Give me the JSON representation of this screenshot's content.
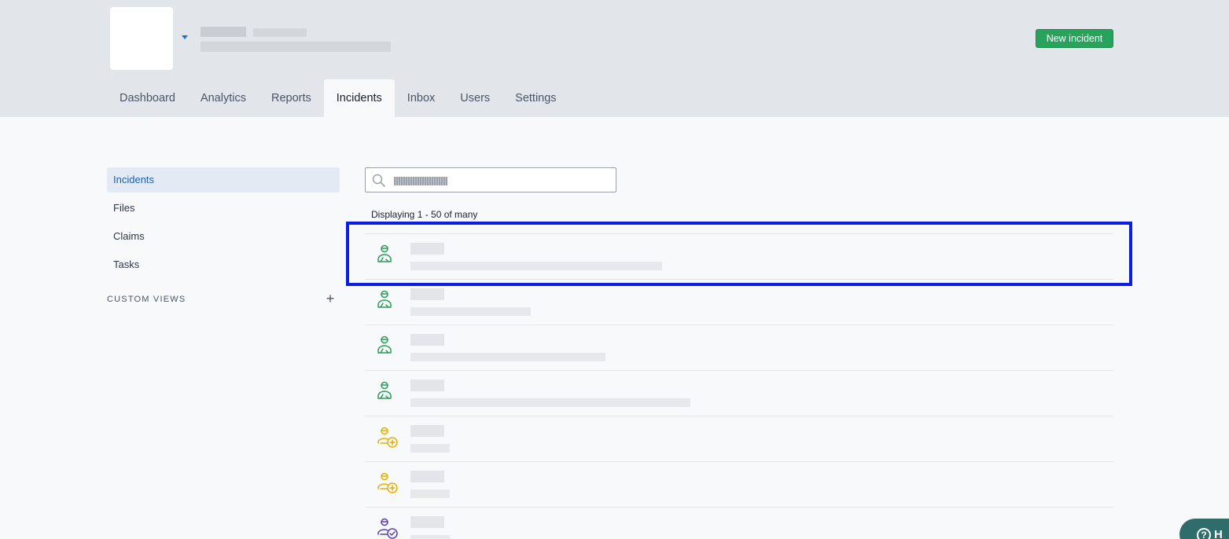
{
  "header": {
    "new_incident_label": "New incident",
    "accent_color": "#27a35b"
  },
  "tabs": [
    {
      "label": "Dashboard"
    },
    {
      "label": "Analytics"
    },
    {
      "label": "Reports"
    },
    {
      "label": "Incidents",
      "active": true
    },
    {
      "label": "Inbox"
    },
    {
      "label": "Users"
    },
    {
      "label": "Settings"
    }
  ],
  "sidebar": {
    "items": [
      {
        "label": "Incidents",
        "active": true
      },
      {
        "label": "Files"
      },
      {
        "label": "Claims"
      },
      {
        "label": "Tasks"
      }
    ],
    "custom_views_label": "CUSTOM VIEWS",
    "add_icon": "plus-icon"
  },
  "search": {
    "icon": "search-icon",
    "placeholder": ""
  },
  "list": {
    "count_text": "Displaying 1 - 50 of many",
    "rows": [
      {
        "icon": "worker-injury-icon",
        "color": "#2e9a5c"
      },
      {
        "icon": "worker-injury-icon",
        "color": "#2e9a5c"
      },
      {
        "icon": "worker-injury-icon",
        "color": "#2e9a5c"
      },
      {
        "icon": "worker-injury-icon",
        "color": "#2e9a5c"
      },
      {
        "icon": "worker-add-icon",
        "color": "#e0b100"
      },
      {
        "icon": "worker-add-icon",
        "color": "#e0b100"
      },
      {
        "icon": "worker-check-icon",
        "color": "#5b3fb5"
      }
    ]
  },
  "help": {
    "label": "H"
  }
}
